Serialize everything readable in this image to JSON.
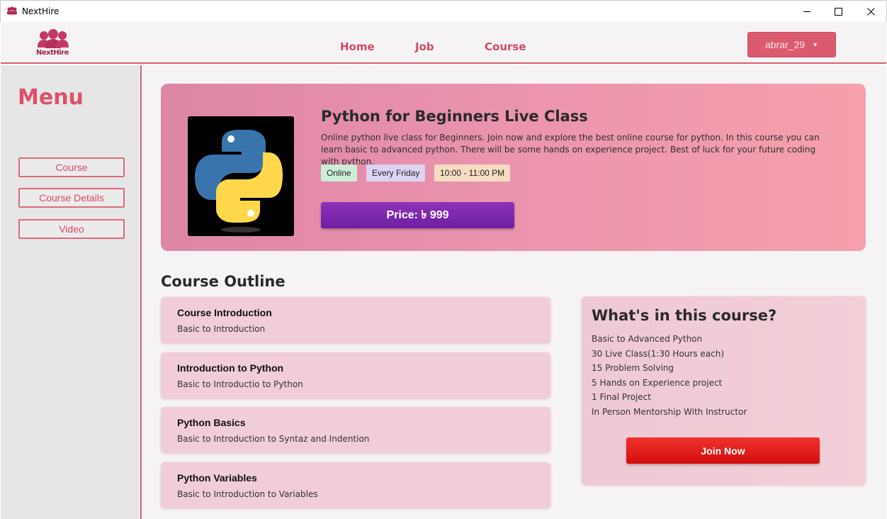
{
  "window": {
    "title": "NextHire",
    "controls": [
      "minimize-icon",
      "maximize-icon",
      "close-icon"
    ]
  },
  "header": {
    "logo_text": "NextHire",
    "nav": [
      {
        "label": "Home"
      },
      {
        "label": "Job"
      },
      {
        "label": "Course"
      }
    ],
    "user": {
      "name": "abrar_29",
      "icon": "chevron-down-icon"
    }
  },
  "sidebar": {
    "title": "Menu",
    "items": [
      {
        "label": "Course"
      },
      {
        "label": "Course Details"
      },
      {
        "label": "Video"
      }
    ]
  },
  "hero": {
    "image_icon": "python-logo",
    "title": "Python for Beginners Live Class",
    "description": "Online python live class for Beginners. Join now and explore the best online course for python. In this course you can learn basic to advanced python. There will be some hands on experience project. Best of luck for your future coding with python.",
    "tags": [
      {
        "label": "Online",
        "color": "#cdeed6"
      },
      {
        "label": "Every Friday",
        "color": "#ddd3f3"
      },
      {
        "label": "10:00 - 11:00 PM",
        "color": "#f6dcc3"
      }
    ],
    "price_label": "Price: ৳ 999"
  },
  "outline": {
    "title": "Course Outline",
    "items": [
      {
        "title": "Course Introduction",
        "subtitle": "Basic to Introduction"
      },
      {
        "title": "Introduction to Python",
        "subtitle": "Basic to Introductio to Python"
      },
      {
        "title": "Python Basics",
        "subtitle": "Basic to Introduction to Syntaz and Indention"
      },
      {
        "title": "Python Variables",
        "subtitle": "Basic to Introduction to Variables"
      }
    ]
  },
  "course_info": {
    "title": "What's in this course?",
    "features": [
      "Basic to Advanced Python",
      "30 Live Class(1:30 Hours each)",
      "15 Problem Solving",
      "5 Hands on Experience project",
      "1 Final Project",
      "In Person Mentorship With Instructor"
    ],
    "join_label": "Join Now"
  },
  "colors": {
    "accent": "#d9606f",
    "price_button": "#7d28ad",
    "join_button": "#e01d1d"
  }
}
